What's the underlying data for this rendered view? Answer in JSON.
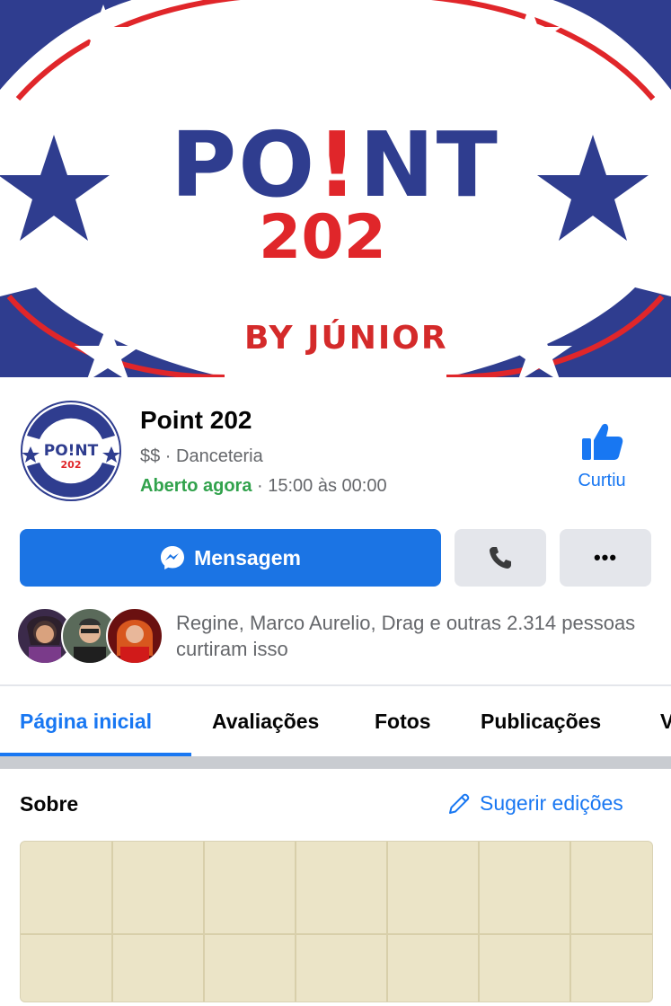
{
  "cover": {
    "logo_word": "PO",
    "logo_word_end": "NT",
    "logo_number": "202",
    "logo_byline": "BY JÚNIOR",
    "colors": {
      "blue": "#2f3d8f",
      "red": "#e0262a"
    }
  },
  "profile": {
    "name": "Point 202",
    "category": "$$ · Danceteria",
    "open_status": "Aberto agora",
    "hours": " · 15:00 às 00:00",
    "like_label": "Curtiu",
    "avatar_text": "PO!NT 202"
  },
  "actions": {
    "message_label": "Mensagem",
    "call_icon": "phone-icon",
    "more_label": "•••"
  },
  "social": {
    "likes_text": "Regine, Marco Aurelio, Drag e outras 2.314 pessoas curtiram isso"
  },
  "tabs": [
    {
      "label": "Página inicial",
      "active": true
    },
    {
      "label": "Avaliações",
      "active": false
    },
    {
      "label": "Fotos",
      "active": false
    },
    {
      "label": "Publicações",
      "active": false
    },
    {
      "label": "V",
      "active": false
    }
  ],
  "about": {
    "title": "Sobre",
    "suggest_label": "Sugerir edições"
  },
  "theme": {
    "accent": "#1877f2",
    "open_green": "#31a24c",
    "map_bg": "#ebe4c7"
  }
}
